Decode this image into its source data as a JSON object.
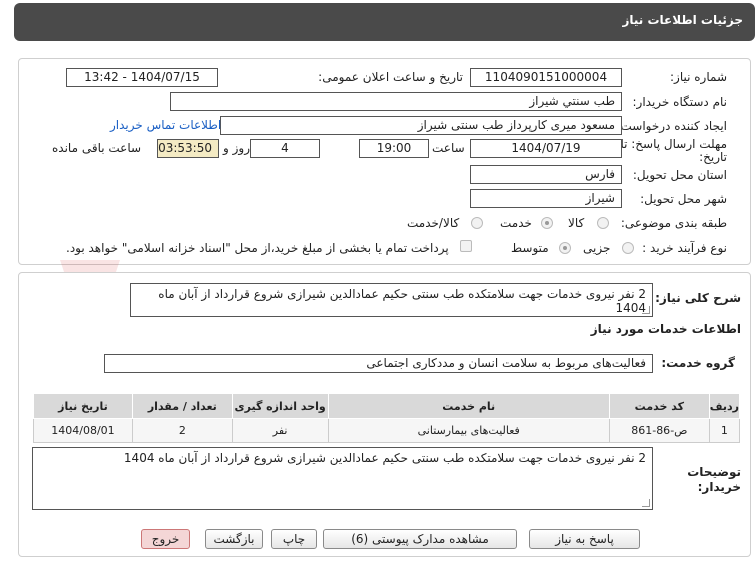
{
  "header": {
    "title": "جزئیات اطلاعات نیاز"
  },
  "fields": {
    "need_number_label": "شماره نیاز:",
    "need_number": "1104090151000004",
    "announce_label": "تاریخ و ساعت اعلان عمومی:",
    "announce_value": "1404/07/15 - 13:42",
    "buyer_org_label": "نام دستگاه خریدار:",
    "buyer_org": "طب سنتي شيراز",
    "creator_label": "ایجاد کننده درخواست:",
    "creator": "مسعود میری کارپرداز طب سنتی شیراز",
    "contact_link": "اطلاعات تماس خریدار",
    "deadline_label_1": "مهلت ارسال پاسخ: تا",
    "deadline_label_2": "تاریخ:",
    "deadline_date": "1404/07/19",
    "time_label": "ساعت",
    "deadline_time": "19:00",
    "days_value": "4",
    "days_label": "روز و",
    "remaining_time": "03:53:50",
    "remaining_label": "ساعت باقی مانده",
    "province_label": "استان محل تحویل:",
    "province": "فارس",
    "city_label": "شهر محل تحویل:",
    "city": "شیراز",
    "category_label": "طبقه بندی موضوعی:",
    "category_options": [
      "کالا",
      "خدمت",
      "کالا/خدمت"
    ],
    "category_selected": "خدمت",
    "process_label": "نوع فرآیند خرید :",
    "process_options": [
      "جزیی",
      "متوسط"
    ],
    "process_selected": "متوسط",
    "payment_note": "پرداخت تمام یا بخشی از مبلغ خرید،از محل \"اسناد خزانه اسلامی\" خواهد بود."
  },
  "description": {
    "label": "شرح کلی نیاز:",
    "text": "2 نفر نیروی خدمات جهت سلامتکده طب سنتی حکیم عمادالدین شیرازی شروع قرارداد از آبان ماه 1404"
  },
  "services": {
    "section_title": "اطلاعات خدمات مورد نیاز",
    "group_label": "گروه خدمت:",
    "group_value": "فعالیت‌های مربوط به سلامت انسان و مددکاری اجتماعی",
    "columns": [
      "ردیف",
      "کد خدمت",
      "نام خدمت",
      "واحد اندازه گیری",
      "تعداد / مقدار",
      "تاریخ نیاز"
    ],
    "rows": [
      [
        "1",
        "ص-86-861",
        "فعالیت‌های بیمارستانی",
        "نفر",
        "2",
        "1404/08/01"
      ]
    ]
  },
  "buyer_notes": {
    "label_1": "توضیحات",
    "label_2": "خریدار:",
    "text": "2 نفر نیروی خدمات جهت سلامتکده طب سنتی حکیم عمادالدین شیرازی شروع قرارداد از آبان ماه 1404"
  },
  "buttons": {
    "reply": "پاسخ به نیاز",
    "attachments": "مشاهده مدارک پیوستی (6)",
    "print": "چاپ",
    "back": "بازگشت",
    "exit": "خروج"
  },
  "watermark": {
    "text": "AriaTender.net"
  },
  "colors": {
    "header_bg": "#4a4a4a",
    "link": "#1a5fc4",
    "remaining_bg": "#f4ebc4",
    "exit_bg": "#f4d6d6"
  }
}
